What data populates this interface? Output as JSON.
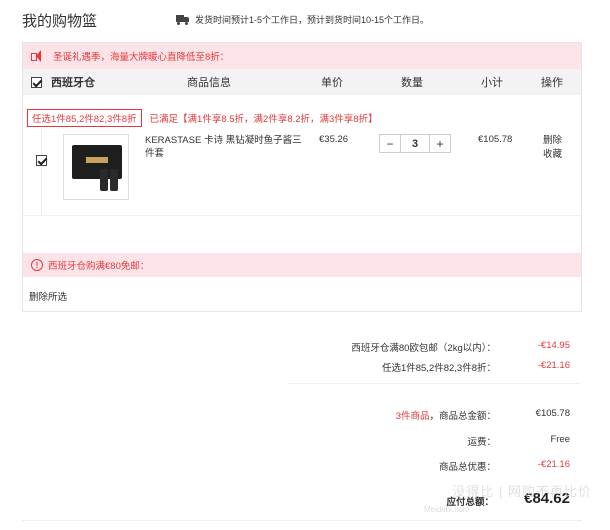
{
  "page": {
    "title": "我的购物篮",
    "shipping_note": "发货时间预计1-5个工作日，预计到货时间10-15个工作日。"
  },
  "cart": {
    "promo_banner": "圣诞礼遇季，海量大牌暖心直降低至8折：",
    "headers": {
      "warehouse": "西班牙仓",
      "info": "商品信息",
      "unit_price": "单价",
      "quantity": "数量",
      "subtotal": "小计",
      "actions": "操作"
    },
    "discount_tag": "任选1件85,2件82,3件8折",
    "discount_status": "已满足【满1件享8.5折，满2件享8.2折，满3件享8折】",
    "item": {
      "name": "KERASTASE 卡诗 黑钻凝时鱼子酱三件套",
      "price": "€35.26",
      "quantity": "3",
      "minus": "−",
      "plus": "+",
      "subtotal": "€105.78",
      "delete": "删除",
      "favorite": "收藏"
    },
    "free_shipping_notice": "西班牙仓购满€80免邮：",
    "delete_selected": "删除所选"
  },
  "summary": {
    "free_shipping_label": "西班牙仓满80欧包邮（2kg以内）：",
    "free_shipping_value": "-€14.95",
    "discount_label": "任选1件85,2件82,3件8折：",
    "discount_value": "-€21.16",
    "item_count": "3件商品",
    "goods_total_label": "，商品总金额：",
    "goods_total_value": "€105.78",
    "shipping_label": "运费：",
    "shipping_value": "Free",
    "total_discount_label": "商品总优惠：",
    "total_discount_value": "-€21.16",
    "payable_label": "应付总额：",
    "payable_value": "€84.62"
  },
  "watermark": {
    "text": "没得比 | 网购不再比价",
    "sub": "Meidebi.com"
  },
  "colors": {
    "accent": "#e4393c",
    "banner_bg": "#fde3e7",
    "header_bg": "#f3f3f3"
  }
}
